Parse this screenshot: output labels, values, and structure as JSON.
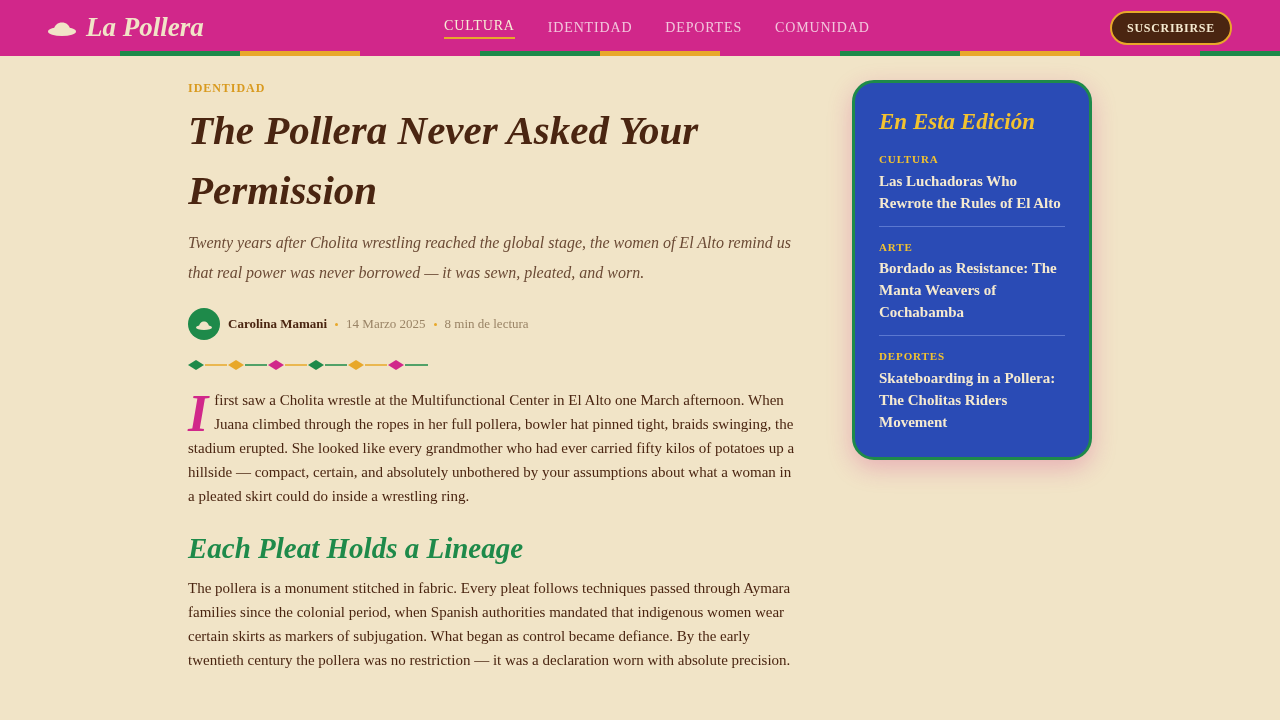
{
  "header": {
    "logo": "La Pollera",
    "nav": [
      {
        "label": "CULTURA",
        "selected": true
      },
      {
        "label": "IDENTIDAD",
        "selected": false
      },
      {
        "label": "DEPORTES",
        "selected": false
      },
      {
        "label": "COMUNIDAD",
        "selected": false
      }
    ],
    "subscribe_button": "SUSCRIBIRSE"
  },
  "article": {
    "category": "IDENTIDAD",
    "title": "The Pollera Never Asked Your Permission",
    "subtitle": "Twenty years after Cholita wrestling reached the global stage, the women of El Alto remind us that real power was never borrowed — it was sewn, pleated, and worn.",
    "byline": {
      "author": "Carolina Mamani",
      "date": "14 Marzo 2025",
      "reading_time": "8 min de lectura"
    },
    "body": [
      {
        "kind": "paragraph",
        "drop_cap": "I",
        "text": "first saw a Cholita wrestle at the Multifunctional Center in El Alto one March afternoon. When Juana climbed through the ropes in her full pollera, bowler hat pinned tight, braids swinging, the stadium erupted. She looked like every grandmother who had ever carried fifty kilos of potatoes up a hillside — compact, certain, and absolutely unbothered by your assumptions about what a woman in a pleated skirt could do inside a wrestling ring."
      },
      {
        "kind": "heading",
        "text": "Each Pleat Holds a Lineage"
      },
      {
        "kind": "paragraph",
        "text": "The pollera is a monument stitched in fabric. Every pleat follows techniques passed through Aymara families since the colonial period, when Spanish authorities mandated that indigenous women wear certain skirts as markers of subjugation. What began as control became defiance. By the early twentieth century the pollera was no restriction — it was a declaration worn with absolute precision."
      }
    ]
  },
  "sidebar": {
    "title": "En Esta Edición",
    "items": [
      {
        "category": "CULTURA",
        "title": "Las Luchadoras Who Rewrote the Rules of El Alto"
      },
      {
        "category": "ARTE",
        "title": "Bordado as Resistance: The Manta Weavers of Cochabamba"
      },
      {
        "category": "DEPORTES",
        "title": "Skateboarding in a Pollera: The Cholitas Riders Movement"
      }
    ]
  }
}
